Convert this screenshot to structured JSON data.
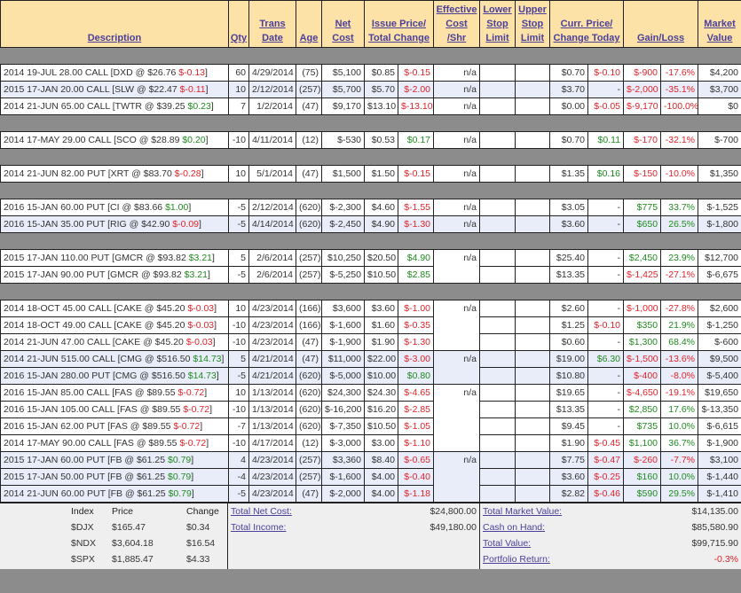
{
  "headers": {
    "description": "Description",
    "qty": "Qty",
    "trans_date": [
      "Trans",
      "Date"
    ],
    "age": "Age",
    "net_cost": [
      "Net",
      "Cost"
    ],
    "issue_price": [
      "Issue Price/",
      "Total Change"
    ],
    "effective_cost": [
      "Effective",
      "Cost",
      "/Shr"
    ],
    "lower_stop": [
      "Lower",
      "Stop",
      "Limit"
    ],
    "upper_stop": [
      "Upper",
      "Stop",
      "Limit"
    ],
    "curr_price": [
      "Curr. Price/",
      "Change Today"
    ],
    "gain_loss": "Gain/Loss",
    "market_value": [
      "Market",
      "Value"
    ]
  },
  "groups": [
    {
      "rows": [
        {
          "alt": false,
          "desc": "2014 19-JUL 28.00 CALL [DXD @ $26.76 ",
          "und_chg": "$-0.13",
          "und_sign": "neg",
          "qty": "60",
          "date": "4/29/2014",
          "age": "(75)",
          "net_cost": "$5,100",
          "issue": "$0.85",
          "tchg": "$-0.15",
          "tchg_sign": "neg",
          "eff": "n/a",
          "curr": "$0.70",
          "today": "$-0.10",
          "today_sign": "neg",
          "gl": "$-900",
          "glp": "-17.6%",
          "gl_sign": "neg",
          "mv": "$4,200"
        },
        {
          "alt": true,
          "desc": "2015 17-JAN 20.00 CALL [SLW @ $22.47 ",
          "und_chg": "$-0.11",
          "und_sign": "neg",
          "qty": "10",
          "date": "2/12/2014",
          "age": "(257)",
          "net_cost": "$5,700",
          "issue": "$5.70",
          "tchg": "$-2.00",
          "tchg_sign": "neg",
          "eff": "n/a",
          "curr": "$3.70",
          "today": "-",
          "today_sign": "",
          "gl": "$-2,000",
          "glp": "-35.1%",
          "gl_sign": "neg",
          "mv": "$3,700"
        },
        {
          "alt": false,
          "desc": "2014 21-JUN 65.00 CALL [TWTR @ $39.25 ",
          "und_chg": "$0.23",
          "und_sign": "pos",
          "qty": "7",
          "date": "1/2/2014",
          "age": "(47)",
          "net_cost": "$9,170",
          "issue": "$13.10",
          "tchg": "$-13.10",
          "tchg_sign": "neg",
          "eff": "n/a",
          "curr": "$0.00",
          "today": "$-0.05",
          "today_sign": "neg",
          "gl": "$-9,170",
          "glp": "-100.0%",
          "gl_sign": "neg",
          "mv": "$0"
        }
      ]
    },
    {
      "rows": [
        {
          "alt": false,
          "desc": "2014 17-MAY 29.00 CALL [SCO @ $28.89 ",
          "und_chg": "$0.20",
          "und_sign": "pos",
          "qty": "-10",
          "date": "4/11/2014",
          "age": "(12)",
          "net_cost": "$-530",
          "issue": "$0.53",
          "tchg": "$0.17",
          "tchg_sign": "pos",
          "eff": "n/a",
          "curr": "$0.70",
          "today": "$0.11",
          "today_sign": "pos",
          "gl": "$-170",
          "glp": "-32.1%",
          "gl_sign": "neg",
          "mv": "$-700"
        }
      ]
    },
    {
      "rows": [
        {
          "alt": false,
          "desc": "2014 21-JUN 82.00 PUT [XRT @ $83.70 ",
          "und_chg": "$-0.28",
          "und_sign": "neg",
          "qty": "10",
          "date": "5/1/2014",
          "age": "(47)",
          "net_cost": "$1,500",
          "issue": "$1.50",
          "tchg": "$-0.15",
          "tchg_sign": "neg",
          "eff": "n/a",
          "curr": "$1.35",
          "today": "$0.16",
          "today_sign": "pos",
          "gl": "$-150",
          "glp": "-10.0%",
          "gl_sign": "neg",
          "mv": "$1,350"
        }
      ]
    },
    {
      "rows": [
        {
          "alt": false,
          "desc": "2016 15-JAN 60.00 PUT [CI @ $83.66 ",
          "und_chg": "$1.00",
          "und_sign": "pos",
          "qty": "-5",
          "date": "2/12/2014",
          "age": "(620)",
          "net_cost": "$-2,300",
          "issue": "$4.60",
          "tchg": "$-1.55",
          "tchg_sign": "neg",
          "eff": "n/a",
          "curr": "$3.05",
          "today": "-",
          "today_sign": "",
          "gl": "$775",
          "glp": "33.7%",
          "gl_sign": "pos",
          "mv": "$-1,525"
        },
        {
          "alt": true,
          "desc": "2016 15-JAN 35.00 PUT [RIG @ $42.90 ",
          "und_chg": "$-0.09",
          "und_sign": "neg",
          "qty": "-5",
          "date": "4/14/2014",
          "age": "(620)",
          "net_cost": "$-2,450",
          "issue": "$4.90",
          "tchg": "$-1.30",
          "tchg_sign": "neg",
          "eff": "n/a",
          "curr": "$3.60",
          "today": "-",
          "today_sign": "",
          "gl": "$650",
          "glp": "26.5%",
          "gl_sign": "pos",
          "mv": "$-1,800"
        }
      ]
    },
    {
      "rows": [
        {
          "alt": false,
          "desc": "2015 17-JAN 110.00 PUT [GMCR @ $93.82 ",
          "und_chg": "$3.21",
          "und_sign": "pos",
          "qty": "5",
          "date": "2/6/2014",
          "age": "(257)",
          "net_cost": "$10,250",
          "issue": "$20.50",
          "tchg": "$4.90",
          "tchg_sign": "pos",
          "eff": "n/a",
          "eff_span": 2,
          "curr": "$25.40",
          "today": "-",
          "today_sign": "",
          "gl": "$2,450",
          "glp": "23.9%",
          "gl_sign": "pos",
          "mv": "$12,700"
        },
        {
          "alt": false,
          "desc": "2015 17-JAN 90.00 PUT [GMCR @ $93.82 ",
          "und_chg": "$3.21",
          "und_sign": "pos",
          "qty": "-5",
          "date": "2/6/2014",
          "age": "(257)",
          "net_cost": "$-5,250",
          "issue": "$10.50",
          "tchg": "$2.85",
          "tchg_sign": "pos",
          "eff_skip": true,
          "curr": "$13.35",
          "today": "-",
          "today_sign": "",
          "gl": "$-1,425",
          "glp": "-27.1%",
          "gl_sign": "neg",
          "mv": "$-6,675"
        }
      ]
    },
    {
      "rows": [
        {
          "alt": false,
          "desc": "2014 18-OCT 45.00 CALL [CAKE @ $45.20 ",
          "und_chg": "$-0.03",
          "und_sign": "neg",
          "qty": "10",
          "date": "4/23/2014",
          "age": "(166)",
          "net_cost": "$3,600",
          "issue": "$3.60",
          "tchg": "$-1.00",
          "tchg_sign": "neg",
          "eff": "n/a",
          "eff_span": 3,
          "curr": "$2.60",
          "today": "-",
          "today_sign": "",
          "gl": "$-1,000",
          "glp": "-27.8%",
          "gl_sign": "neg",
          "mv": "$2,600"
        },
        {
          "alt": false,
          "desc": "2014 18-OCT 49.00 CALL [CAKE @ $45.20 ",
          "und_chg": "$-0.03",
          "und_sign": "neg",
          "qty": "-10",
          "date": "4/23/2014",
          "age": "(166)",
          "net_cost": "$-1,600",
          "issue": "$1.60",
          "tchg": "$-0.35",
          "tchg_sign": "neg",
          "eff_skip": true,
          "curr": "$1.25",
          "today": "$-0.10",
          "today_sign": "neg",
          "gl": "$350",
          "glp": "21.9%",
          "gl_sign": "pos",
          "mv": "$-1,250"
        },
        {
          "alt": false,
          "desc": "2014 21-JUN 47.00 CALL [CAKE @ $45.20 ",
          "und_chg": "$-0.03",
          "und_sign": "neg",
          "qty": "-10",
          "date": "4/23/2014",
          "age": "(47)",
          "net_cost": "$-1,900",
          "issue": "$1.90",
          "tchg": "$-1.30",
          "tchg_sign": "neg",
          "eff_skip": true,
          "curr": "$0.60",
          "today": "-",
          "today_sign": "",
          "gl": "$1,300",
          "glp": "68.4%",
          "gl_sign": "pos",
          "mv": "$-600"
        },
        {
          "alt": true,
          "desc": "2014 21-JUN 515.00 CALL [CMG @ $516.50 ",
          "und_chg": "$14.73",
          "und_sign": "pos",
          "qty": "5",
          "date": "4/21/2014",
          "age": "(47)",
          "net_cost": "$11,000",
          "issue": "$22.00",
          "tchg": "$-3.00",
          "tchg_sign": "neg",
          "eff": "n/a",
          "eff_span": 2,
          "curr": "$19.00",
          "today": "$6.30",
          "today_sign": "pos",
          "gl": "$-1,500",
          "glp": "-13.6%",
          "gl_sign": "neg",
          "mv": "$9,500"
        },
        {
          "alt": true,
          "desc": "2016 15-JAN 280.00 PUT [CMG @ $516.50 ",
          "und_chg": "$14.73",
          "und_sign": "pos",
          "qty": "-5",
          "date": "4/21/2014",
          "age": "(620)",
          "net_cost": "$-5,000",
          "issue": "$10.00",
          "tchg": "$0.80",
          "tchg_sign": "pos",
          "eff_skip": true,
          "curr": "$10.80",
          "today": "-",
          "today_sign": "",
          "gl": "$-400",
          "glp": "-8.0%",
          "gl_sign": "neg",
          "mv": "$-5,400"
        },
        {
          "alt": false,
          "desc": "2016 15-JAN 85.00 CALL [FAS @ $89.55 ",
          "und_chg": "$-0.72",
          "und_sign": "neg",
          "qty": "10",
          "date": "1/13/2014",
          "age": "(620)",
          "net_cost": "$24,300",
          "issue": "$24.30",
          "tchg": "$-4.65",
          "tchg_sign": "neg",
          "eff": "n/a",
          "eff_span": 4,
          "curr": "$19.65",
          "today": "-",
          "today_sign": "",
          "gl": "$-4,650",
          "glp": "-19.1%",
          "gl_sign": "neg",
          "mv": "$19,650"
        },
        {
          "alt": false,
          "desc": "2016 15-JAN 105.00 CALL [FAS @ $89.55 ",
          "und_chg": "$-0.72",
          "und_sign": "neg",
          "qty": "-10",
          "date": "1/13/2014",
          "age": "(620)",
          "net_cost": "$-16,200",
          "issue": "$16.20",
          "tchg": "$-2.85",
          "tchg_sign": "neg",
          "eff_skip": true,
          "curr": "$13.35",
          "today": "-",
          "today_sign": "",
          "gl": "$2,850",
          "glp": "17.6%",
          "gl_sign": "pos",
          "mv": "$-13,350"
        },
        {
          "alt": false,
          "desc": "2016 15-JAN 62.00 PUT [FAS @ $89.55 ",
          "und_chg": "$-0.72",
          "und_sign": "neg",
          "qty": "-7",
          "date": "1/13/2014",
          "age": "(620)",
          "net_cost": "$-7,350",
          "issue": "$10.50",
          "tchg": "$-1.05",
          "tchg_sign": "neg",
          "eff_skip": true,
          "curr": "$9.45",
          "today": "-",
          "today_sign": "",
          "gl": "$735",
          "glp": "10.0%",
          "gl_sign": "pos",
          "mv": "$-6,615"
        },
        {
          "alt": false,
          "desc": "2014 17-MAY 90.00 CALL [FAS @ $89.55 ",
          "und_chg": "$-0.72",
          "und_sign": "neg",
          "qty": "-10",
          "date": "4/17/2014",
          "age": "(12)",
          "net_cost": "$-3,000",
          "issue": "$3.00",
          "tchg": "$-1.10",
          "tchg_sign": "neg",
          "eff_skip": true,
          "curr": "$1.90",
          "today": "$-0.45",
          "today_sign": "neg",
          "gl": "$1,100",
          "glp": "36.7%",
          "gl_sign": "pos",
          "mv": "$-1,900"
        },
        {
          "alt": true,
          "desc": "2015 17-JAN 60.00 PUT [FB @ $61.25 ",
          "und_chg": "$0.79",
          "und_sign": "pos",
          "qty": "4",
          "date": "4/23/2014",
          "age": "(257)",
          "net_cost": "$3,360",
          "issue": "$8.40",
          "tchg": "$-0.65",
          "tchg_sign": "neg",
          "eff": "n/a",
          "eff_span": 3,
          "curr": "$7.75",
          "today": "$-0.47",
          "today_sign": "neg",
          "gl": "$-260",
          "glp": "-7.7%",
          "gl_sign": "neg",
          "mv": "$3,100"
        },
        {
          "alt": true,
          "desc": "2015 17-JAN 50.00 PUT [FB @ $61.25 ",
          "und_chg": "$0.79",
          "und_sign": "pos",
          "qty": "-4",
          "date": "4/23/2014",
          "age": "(257)",
          "net_cost": "$-1,600",
          "issue": "$4.00",
          "tchg": "$-0.40",
          "tchg_sign": "neg",
          "eff_skip": true,
          "curr": "$3.60",
          "today": "$-0.25",
          "today_sign": "neg",
          "gl": "$160",
          "glp": "10.0%",
          "gl_sign": "pos",
          "mv": "$-1,440"
        },
        {
          "alt": true,
          "desc": "2014 21-JUN 60.00 PUT [FB @ $61.25 ",
          "und_chg": "$0.79",
          "und_sign": "pos",
          "qty": "-5",
          "date": "4/23/2014",
          "age": "(47)",
          "net_cost": "$-2,000",
          "issue": "$4.00",
          "tchg": "$-1.18",
          "tchg_sign": "neg",
          "eff_skip": true,
          "curr": "$2.82",
          "today": "$-0.46",
          "today_sign": "neg",
          "gl": "$590",
          "glp": "29.5%",
          "gl_sign": "pos",
          "mv": "$-1,410"
        }
      ]
    }
  ],
  "indices": {
    "headers": [
      "Index",
      "Price",
      "Change"
    ],
    "rows": [
      {
        "index": "$DJX",
        "price": "$165.47",
        "change": "$0.34"
      },
      {
        "index": "$NDX",
        "price": "$3,604.18",
        "change": "$16.54"
      },
      {
        "index": "$SPX",
        "price": "$1,885.47",
        "change": "$4.33"
      }
    ]
  },
  "totals_left": [
    {
      "label": "Total Net Cost:",
      "value": "$24,800.00"
    },
    {
      "label": "Total Income:",
      "value": "$49,180.00"
    }
  ],
  "totals_right": [
    {
      "label": "Total Market Value:",
      "value": "$14,135.00",
      "sign": ""
    },
    {
      "label": "Cash on Hand:",
      "value": "$85,580.90",
      "sign": ""
    },
    {
      "label": "Total Value:",
      "value": "$99,715.90",
      "sign": ""
    },
    {
      "label": "Portfolio Return:",
      "value": "-0.3%",
      "sign": "neg"
    }
  ],
  "colors": {
    "header_bg": "#fde2a8",
    "link": "#4a3f9a",
    "negative": "#e0242b",
    "positive": "#1f8a1f",
    "alt_row": "#e8edf9",
    "separator": "#8c8c8c"
  }
}
